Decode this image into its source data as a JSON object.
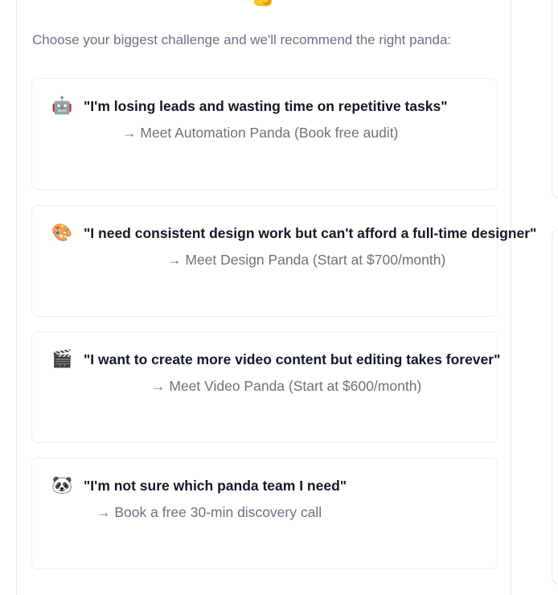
{
  "intro": "Choose your biggest challenge and we'll recommend the right panda:",
  "top_icon": "flexed-arm-emoji",
  "cards": [
    {
      "icon": "🤖",
      "icon_name": "robot-icon",
      "quote": "\"I'm losing leads and wasting time on repetitive tasks\"",
      "action": "→ Meet Automation Panda (Book free audit)"
    },
    {
      "icon": "🎨",
      "icon_name": "palette-icon",
      "quote": "\"I need consistent design work but can't afford a full-time designer\"",
      "action": "→ Meet Design Panda (Start at $700/month)"
    },
    {
      "icon": "🎬",
      "icon_name": "clapperboard-icon",
      "quote": "\"I want to create more video content but editing takes forever\"",
      "action": "→ Meet Video Panda (Start at $600/month)"
    },
    {
      "icon": "🐼",
      "icon_name": "panda-icon",
      "quote": "\"I'm not sure which panda team I need\"",
      "action": "→ Book a free 30-min discovery call"
    }
  ]
}
